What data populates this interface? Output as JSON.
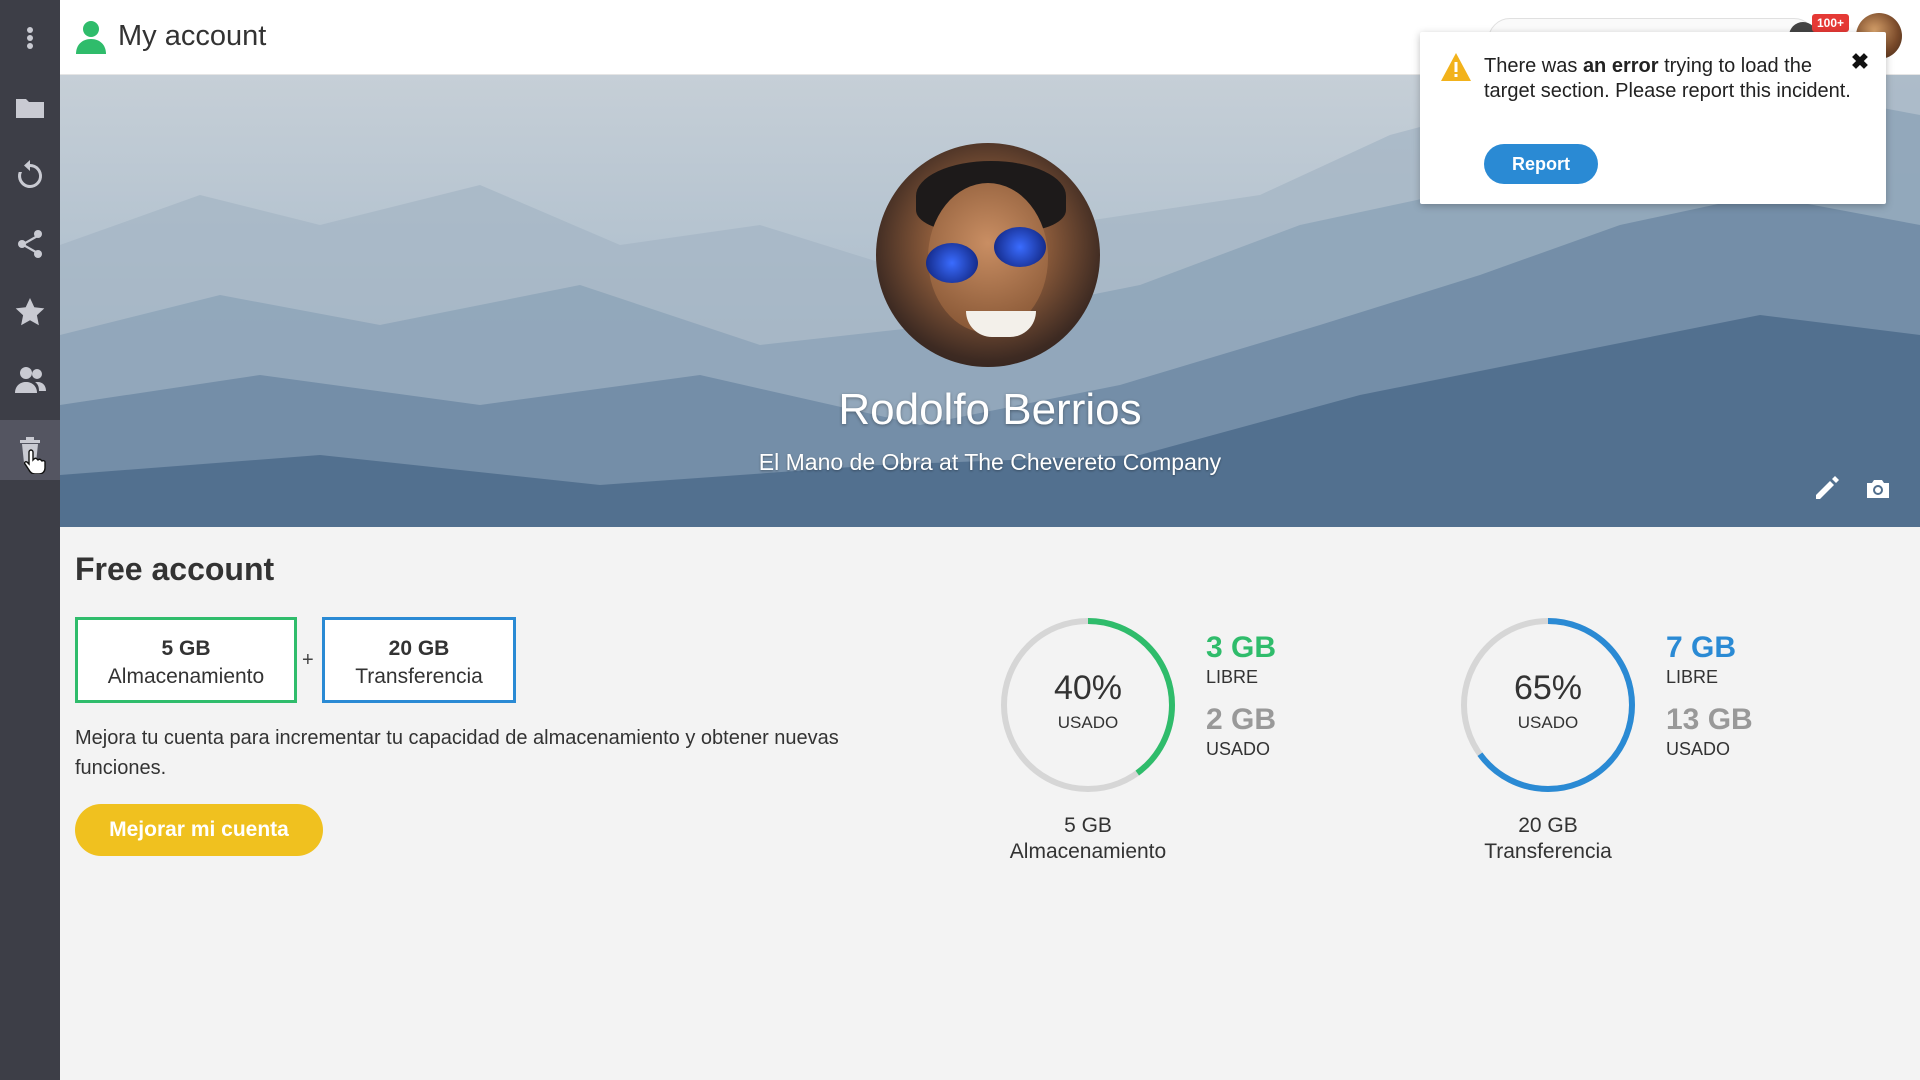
{
  "header": {
    "title": "My account",
    "notifications_badge": "100+"
  },
  "sidebar": {
    "items": [
      {
        "icon": "menu-dots-icon"
      },
      {
        "icon": "folder-icon"
      },
      {
        "icon": "history-icon"
      },
      {
        "icon": "share-icon"
      },
      {
        "icon": "star-icon"
      },
      {
        "icon": "users-icon"
      },
      {
        "icon": "trash-icon"
      }
    ]
  },
  "profile": {
    "name": "Rodolfo Berrios",
    "subtitle": "El Mano de Obra at The Chevereto Company"
  },
  "toast": {
    "message_pre": "There was ",
    "message_bold": "an error",
    "message_post": " trying to load the target section. Please report this incident.",
    "button": "Report",
    "close": "✖"
  },
  "plan": {
    "title": "Free account",
    "storage_value": "5 GB",
    "storage_label": "Almacenamiento",
    "plus": "+",
    "transfer_value": "20 GB",
    "transfer_label": "Transferencia",
    "description": "Mejora tu cuenta para incrementar tu capacidad de almacenamiento y obtener nuevas funciones.",
    "upgrade_button": "Mejorar mi cuenta"
  },
  "usage": [
    {
      "percent_label": "40%",
      "percent": 40,
      "used_label": "USADO",
      "free_value": "3 GB",
      "free_label": "LIBRE",
      "used_value": "2 GB",
      "used_value_label": "USADO",
      "total_value": "5 GB",
      "total_label": "Almacenamiento",
      "color": "#2fbc6b"
    },
    {
      "percent_label": "65%",
      "percent": 65,
      "used_label": "USADO",
      "free_value": "7 GB",
      "free_label": "LIBRE",
      "used_value": "13 GB",
      "used_value_label": "USADO",
      "total_value": "20 GB",
      "total_label": "Transferencia",
      "color": "#2a8ad4"
    }
  ],
  "colors": {
    "green": "#2fbc6b",
    "blue": "#2a8ad4",
    "yellow": "#f0c11f",
    "sidebar": "#3d3e47"
  }
}
